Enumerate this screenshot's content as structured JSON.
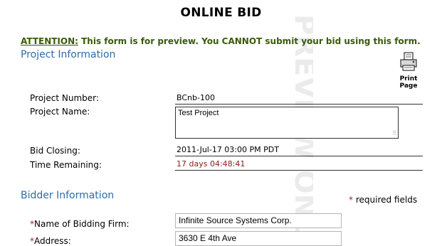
{
  "title": "ONLINE BID",
  "attention": {
    "label": "ATTENTION:",
    "text": " This form is for preview. You CANNOT submit your bid using this form."
  },
  "project": {
    "section_title": "Project Information",
    "print": {
      "line1": "Print",
      "line2": "Page"
    },
    "number_label": "Project Number:",
    "number_value": "BCnb-100",
    "name_label": "Project Name:",
    "name_value": "Test Project",
    "closing_label": "Bid Closing:",
    "closing_value": "2011-Jul-17 03:00 PM PDT",
    "remaining_label": "Time Remaining:",
    "remaining_value": "17 days 04:48:41"
  },
  "bidder": {
    "section_title": "Bidder Information",
    "required_note": "required fields",
    "required_star": "*",
    "firm_label": "Name of Bidding Firm:",
    "firm_value": "Infinite Source Systems Corp.",
    "address_label": "Address:",
    "address_value": "3630 E 4th Ave"
  },
  "watermark_text": "PREVIEW ONLY",
  "colors": {
    "section_title": "#2e6aa8",
    "attention": "#3a5a0a",
    "time_remaining": "#8b1a1a",
    "required": "#b01c1c"
  },
  "icons": {
    "print": "printer-icon",
    "resize": "resize-grip-icon"
  }
}
